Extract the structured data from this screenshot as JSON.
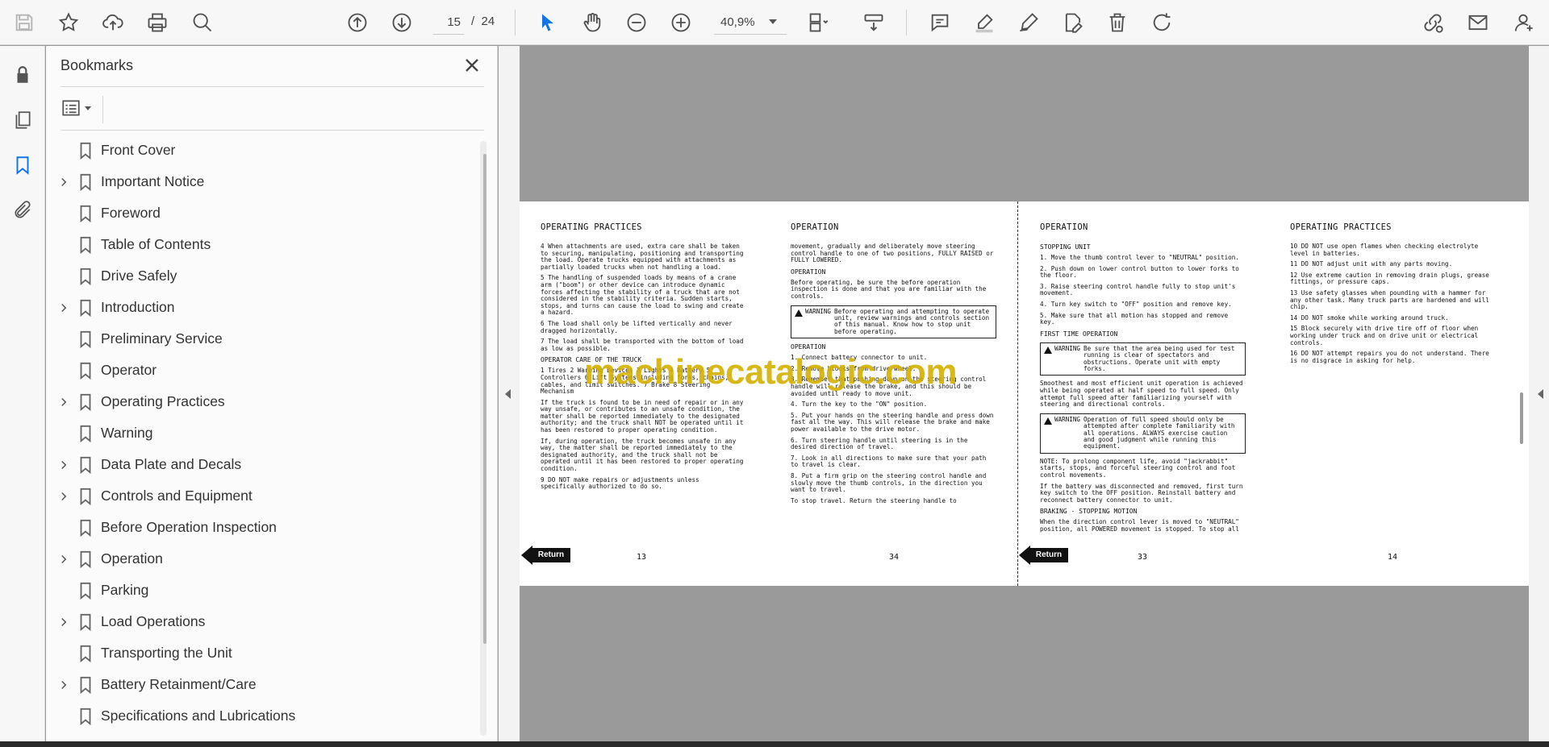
{
  "toolbar": {
    "page_current": "15",
    "page_separator": "/",
    "page_total": "24",
    "zoom": "40,9%",
    "icons": [
      "save-icon",
      "star-icon",
      "upload-icon",
      "print-icon",
      "zoom-search-icon",
      "prev-page-icon",
      "next-page-icon",
      "select-cursor-icon",
      "hand-icon",
      "zoom-out-icon",
      "zoom-in-icon",
      "page-fit-icon",
      "scroll-mode-icon",
      "comment-icon",
      "highlight-icon",
      "sign-icon",
      "edit-icon",
      "delete-icon",
      "rotate-icon",
      "share-link-icon",
      "email-icon",
      "account-icon"
    ]
  },
  "panel": {
    "title": "Bookmarks",
    "items": [
      {
        "label": "Front Cover",
        "expandable": false
      },
      {
        "label": "Important Notice",
        "expandable": true
      },
      {
        "label": "Foreword",
        "expandable": false
      },
      {
        "label": "Table of Contents",
        "expandable": false
      },
      {
        "label": "Drive Safely",
        "expandable": false
      },
      {
        "label": "Introduction",
        "expandable": true
      },
      {
        "label": "Preliminary Service",
        "expandable": false
      },
      {
        "label": "Operator",
        "expandable": false
      },
      {
        "label": "Operating Practices",
        "expandable": true
      },
      {
        "label": "Warning",
        "expandable": false
      },
      {
        "label": "Data Plate and Decals",
        "expandable": true
      },
      {
        "label": "Controls and Equipment",
        "expandable": true
      },
      {
        "label": "Before Operation Inspection",
        "expandable": false
      },
      {
        "label": "Operation",
        "expandable": true
      },
      {
        "label": "Parking",
        "expandable": false
      },
      {
        "label": "Load Operations",
        "expandable": true
      },
      {
        "label": "Transporting the Unit",
        "expandable": false
      },
      {
        "label": "Battery Retainment/Care",
        "expandable": true
      },
      {
        "label": "Specifications and Lubrications",
        "expandable": false
      }
    ]
  },
  "document": {
    "watermark": "machinecatalogic.com",
    "return_label": "Return",
    "pages": [
      {
        "heading": "OPERATING PRACTICES",
        "number": "13",
        "blocks": [
          {
            "t": "p",
            "text": "4   When attachments are used, extra care shall be taken to securing, manipulating, positioning and transporting the load. Operate trucks equipped with attachments as partially loaded trucks when not handling a load."
          },
          {
            "t": "p",
            "text": "5   The handling of suspended loads by means of a crane arm (\"boom\") or other device can introduce dynamic forces affecting the stability of a truck that are not considered in the stability criteria. Sudden starts, stops, and turns can cause the load to swing and create a hazard."
          },
          {
            "t": "p",
            "text": "6   The load shall only be lifted vertically and never dragged horizontally."
          },
          {
            "t": "p",
            "text": "7   The load shall be transported with the bottom of load as low as possible."
          },
          {
            "t": "sub",
            "text": "OPERATOR CARE OF THE TRUCK"
          },
          {
            "t": "p",
            "text": "1  Tires  2  Warning Devices  3  Lights  4  Battery  5  Controllers  6  Lift Systems including forks, chains, cables, and limit switches.  7  Brake  8  Steering Mechanism"
          },
          {
            "t": "p",
            "text": "If the truck is found to be in need of repair or in any way unsafe, or contributes to an unsafe condition, the matter shall be reported immediately to the designated authority; and the truck shall NOT be operated until it has been restored to proper operating condition."
          },
          {
            "t": "p",
            "text": "If, during operation, the truck becomes unsafe in any way, the matter shall be reported immediately to the designated authority, and the truck shall not be operated until it has been restored to proper operating condition."
          },
          {
            "t": "p",
            "text": "9   DO NOT make repairs or adjustments unless specifically authorized to do so."
          }
        ]
      },
      {
        "heading": "OPERATION",
        "number": "34",
        "blocks": [
          {
            "t": "p",
            "text": "movement, gradually and deliberately move steering control handle to one of two positions, FULLY RAISED or FULLY LOWERED."
          },
          {
            "t": "sub",
            "text": "OPERATION"
          },
          {
            "t": "p",
            "text": "Before operating, be sure the before operation inspection is done and that you are familiar with the controls."
          },
          {
            "t": "warn",
            "label": "WARNING",
            "text": "Before operating and attempting to operate unit, review warnings and controls section of this manual. Know how to stop unit before operating."
          },
          {
            "t": "sub",
            "text": "OPERATION"
          },
          {
            "t": "p",
            "text": "1.  Connect battery connector to unit."
          },
          {
            "t": "p",
            "text": "2.  Remove blocks from drive wheel."
          },
          {
            "t": "p",
            "text": "3.  Remember that pushing down on the steering control handle will release the brake, and this should be avoided until ready to move unit."
          },
          {
            "t": "p",
            "text": "4.  Turn the key to the \"ON\" position."
          },
          {
            "t": "p",
            "text": "5.  Put your hands on the steering handle and press down fast all the way. This will release the brake and make power available to the drive motor."
          },
          {
            "t": "p",
            "text": "6.  Turn steering handle until steering is in the desired direction of travel."
          },
          {
            "t": "p",
            "text": "7.  Look in all directions to make sure that your path to travel is clear."
          },
          {
            "t": "p",
            "text": "8.  Put a firm grip on the steering control handle and slowly move the thumb controls, in the direction you want to travel."
          },
          {
            "t": "p",
            "text": "To stop travel.  Return the steering handle to"
          }
        ]
      },
      {
        "heading": "OPERATION",
        "number": "33",
        "blocks": [
          {
            "t": "sub",
            "text": "STOPPING UNIT"
          },
          {
            "t": "p",
            "text": "1.  Move the thumb control lever to \"NEUTRAL\" position."
          },
          {
            "t": "p",
            "text": "2.  Push down on lower control button to lower forks to the floor."
          },
          {
            "t": "p",
            "text": "3.  Raise steering control handle fully to stop unit's movement."
          },
          {
            "t": "p",
            "text": "4.  Turn key switch to \"OFF\" position and remove key."
          },
          {
            "t": "p",
            "text": "5.  Make sure that all motion has stopped and remove key."
          },
          {
            "t": "sub",
            "text": "FIRST TIME OPERATION"
          },
          {
            "t": "warn",
            "label": "WARNING",
            "text": "Be sure that the area being used for test running is clear of spectators and obstructions. Operate unit with empty forks."
          },
          {
            "t": "p",
            "text": "Smoothest and most efficient unit operation is achieved while being operated at half speed to full speed. Only attempt full speed after familiarizing yourself with steering and directional controls."
          },
          {
            "t": "warn",
            "label": "WARNING",
            "text": "Operation of full speed should only be attempted after complete familiarity with all operations. ALWAYS exercise caution and good judgment while running this equipment."
          },
          {
            "t": "p",
            "text": "NOTE:   To prolong component life, avoid \"jackrabbit\" starts, stops, and forceful steering control and foot control movements."
          },
          {
            "t": "p",
            "text": "If the battery was disconnected and removed, first turn key switch to the OFF position. Reinstall battery and reconnect battery connector to unit."
          },
          {
            "t": "sub",
            "text": "BRAKING - STOPPING MOTION"
          },
          {
            "t": "p",
            "text": "When the direction control lever is moved to \"NEUTRAL\" position, all POWERED movement is stopped. To stop all"
          }
        ]
      },
      {
        "heading": "OPERATING PRACTICES",
        "number": "14",
        "blocks": [
          {
            "t": "p",
            "text": "10  DO NOT use open flames when checking electrolyte level in batteries."
          },
          {
            "t": "p",
            "text": "11  DO NOT adjust unit with any parts moving."
          },
          {
            "t": "p",
            "text": "12  Use extreme caution in removing drain plugs, grease fittings, or pressure caps."
          },
          {
            "t": "p",
            "text": "13  Use safety glasses when pounding with a hammer for any other task. Many truck parts are hardened and will chip."
          },
          {
            "t": "p",
            "text": "14  DO NOT smoke while working around truck."
          },
          {
            "t": "p",
            "text": "15  Block securely with drive tire off of floor when working under truck and on drive unit or electrical controls."
          },
          {
            "t": "p",
            "text": "16  DO NOT attempt repairs you do not understand. There is no disgrace in asking for help."
          }
        ]
      }
    ]
  }
}
